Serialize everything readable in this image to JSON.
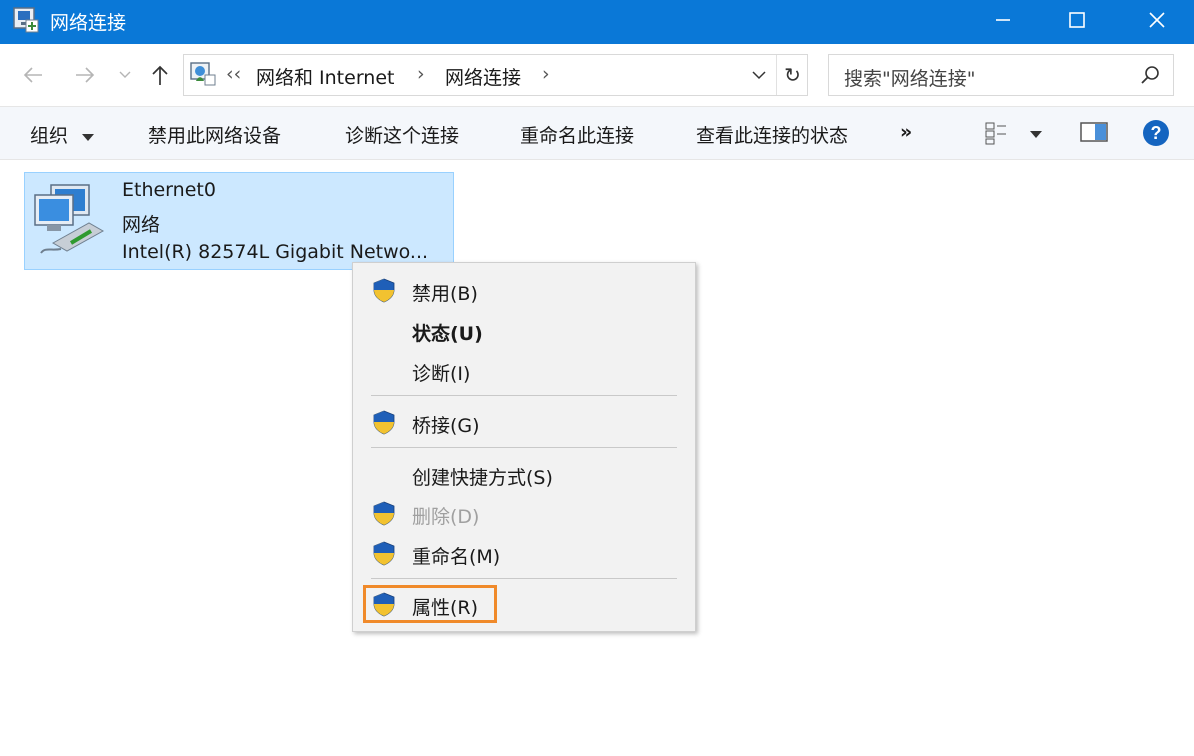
{
  "window": {
    "title": "网络连接",
    "accent_color": "#0a78d7"
  },
  "nav": {
    "back_icon": "arrow-left-icon",
    "forward_icon": "arrow-right-icon",
    "recent_icon": "chevron-down-icon",
    "up_icon": "arrow-up-icon"
  },
  "address": {
    "overflow": "‹‹",
    "crumb1": "网络和 Internet",
    "sep1": "›",
    "crumb2": "网络连接",
    "sep2": "›",
    "refresh": "↻"
  },
  "search": {
    "placeholder": "搜索\"网络连接\""
  },
  "commands": {
    "organize": "组织",
    "disable_device": "禁用此网络设备",
    "diagnose": "诊断这个连接",
    "rename": "重命名此连接",
    "view_status": "查看此连接的状态",
    "more": "»"
  },
  "adapter": {
    "name": "Ethernet0",
    "network": "网络",
    "device": "Intel(R) 82574L Gigabit Netwo..."
  },
  "context_menu": {
    "items": [
      {
        "label": "禁用(B)",
        "shield": true
      },
      {
        "label": "状态(U)",
        "bold": true
      },
      {
        "label": "诊断(I)"
      },
      {
        "label": "桥接(G)",
        "shield": true
      },
      {
        "label": "创建快捷方式(S)"
      },
      {
        "label": "删除(D)",
        "shield": true,
        "disabled": true
      },
      {
        "label": "重命名(M)",
        "shield": true
      },
      {
        "label": "属性(R)",
        "shield": true,
        "highlighted": true
      }
    ],
    "highlight_color": "#f08a2a"
  }
}
